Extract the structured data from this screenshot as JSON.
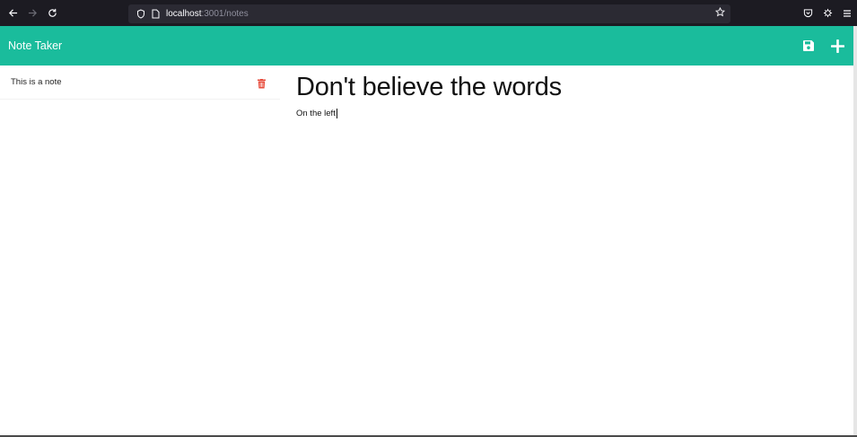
{
  "browser": {
    "url_host": "localhost",
    "url_rest": ":3001/notes",
    "icons": [
      "back-arrow-icon",
      "forward-arrow-icon",
      "reload-icon",
      "shield-icon",
      "page-icon",
      "star-icon",
      "pocket-icon",
      "extension-icon",
      "menu-icon"
    ]
  },
  "header": {
    "title": "Note Taker",
    "accent_color": "#1abc9c",
    "icons": [
      "save-icon",
      "plus-icon"
    ]
  },
  "notes": [
    {
      "title": "This is a note"
    }
  ],
  "delete_color": "#e74c3c",
  "editor": {
    "title_value": "Don't believe the words",
    "body_value": "On the left"
  }
}
